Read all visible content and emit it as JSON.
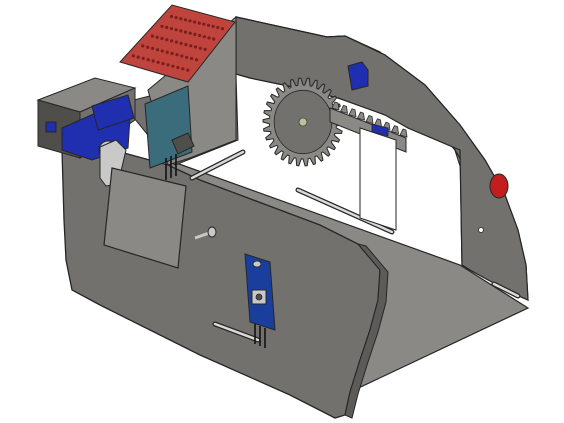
{
  "view": {
    "kind": "isometric 3D CAD render of an open enclosure with electronic modules"
  },
  "colors": {
    "background": "#ffffff",
    "panel_light": "#8b8985",
    "panel_mid": "#73716d",
    "panel_dark": "#5d5b58",
    "edge": "#262626",
    "servo_blue": "#1f2fb0",
    "pcb_red": "#c0443e",
    "pcb_teal": "#3a6c7c",
    "sensor_blue": "#1a3e9c",
    "button_red": "#c21e1e",
    "pin_metal": "#c9c9c9",
    "dark_block": "#4f4e4b"
  },
  "components": {
    "gear_teeth": 30,
    "rack_teeth": 9,
    "slots": 4,
    "pcb_hole_rows": 5,
    "pcb_hole_cols": 12
  }
}
